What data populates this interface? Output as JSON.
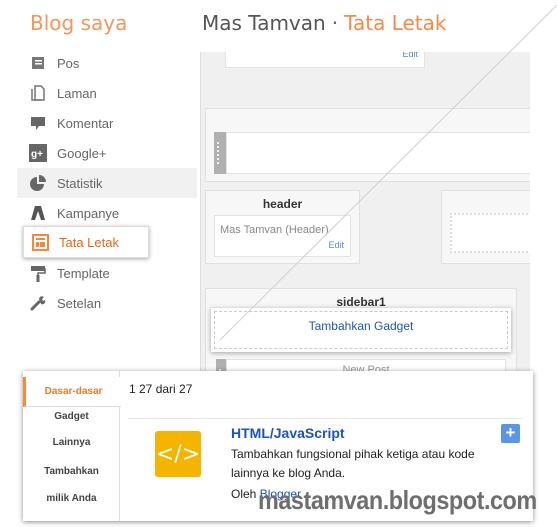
{
  "header": {
    "brand": "Blog saya",
    "blog_name": "Mas Tamvan",
    "separator": "·",
    "page": "Tata Letak"
  },
  "sidebar": {
    "items": [
      {
        "label": "Pos",
        "icon": "posts-icon"
      },
      {
        "label": "Laman",
        "icon": "pages-icon"
      },
      {
        "label": "Komentar",
        "icon": "comment-icon"
      },
      {
        "label": "Google+",
        "icon": "google-plus-icon"
      },
      {
        "label": "Statistik",
        "icon": "pie-chart-icon"
      },
      {
        "label": "Kampanye",
        "icon": "adwords-icon"
      },
      {
        "label": "Tata Letak",
        "icon": "layout-icon",
        "active": true
      },
      {
        "label": "Template",
        "icon": "paint-roller-icon"
      },
      {
        "label": "Setelan",
        "icon": "wrench-icon"
      }
    ]
  },
  "layout": {
    "header_section": {
      "title": "header",
      "gadget": "Mas Tamvan (Header)",
      "edit": "Edit"
    },
    "sidebar_section": {
      "title": "sidebar1",
      "add_gadget": "Tambahkan Gadget",
      "next_gadget": "New Post"
    },
    "top_edit": "Edit"
  },
  "dialog": {
    "tabs": [
      "Dasar-dasar",
      "Gadget",
      "Lainnya",
      "Tambahkan",
      "milik Anda"
    ],
    "active_tab": "Dasar-dasar",
    "count": "1 27 dari 27",
    "gadget": {
      "icon": "</>",
      "title": "HTML/JavaScript",
      "description": "Tambahkan fungsional pihak ketiga atau kode lainnya ke blog Anda.",
      "by_label": "Oleh",
      "by_author": "Blogger",
      "add_label": "+"
    }
  },
  "watermark": "mastamvan.blogspot.com",
  "colors": {
    "accent": "#f58a4b",
    "link": "#1a53c5",
    "gadget_icon": "#f4b400",
    "add_button": "#5a95e8"
  }
}
